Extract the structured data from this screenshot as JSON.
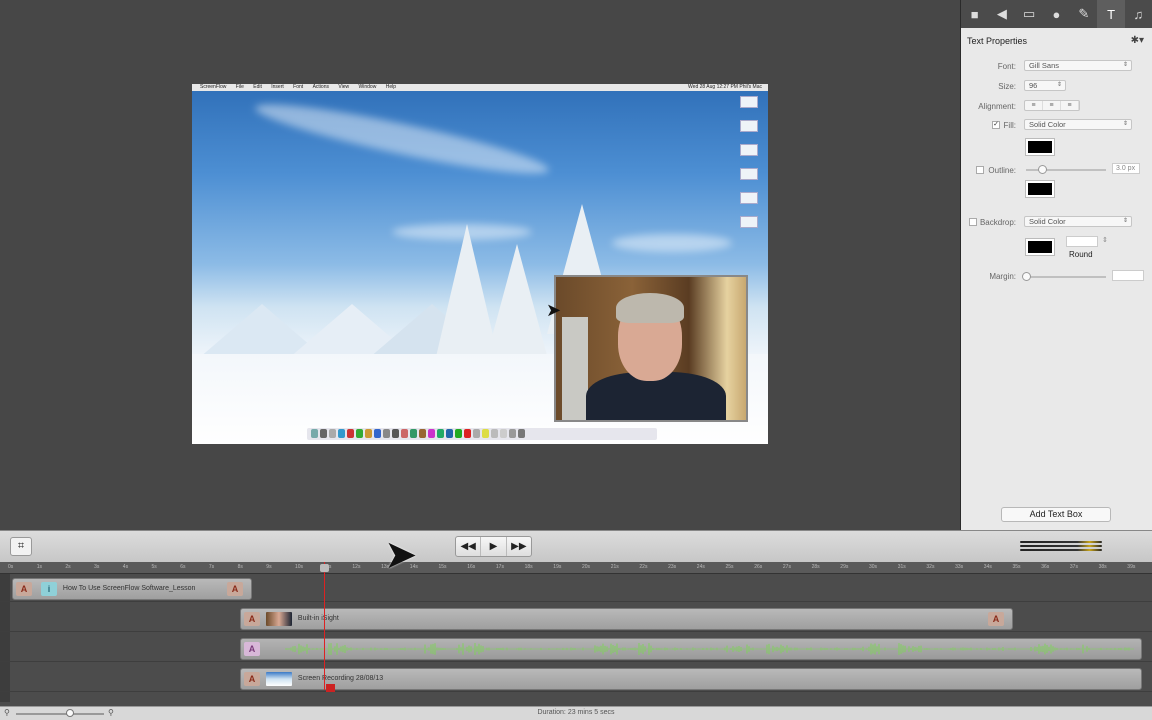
{
  "mac_menubar": {
    "app": "ScreenFlow",
    "items": [
      "File",
      "Edit",
      "Insert",
      "Font",
      "Actions",
      "View",
      "Window",
      "Help"
    ],
    "status": "Wed 28 Aug 12:27 PM  Phil's Mac"
  },
  "inspector": {
    "toolbar": [
      "video-camera-icon",
      "speaker-icon",
      "screen-icon",
      "callout-icon",
      "annotation-icon",
      "text-icon",
      "media-library-icon"
    ],
    "title": "Text Properties",
    "font_label": "Font:",
    "font_value": "Gill Sans",
    "size_label": "Size:",
    "size_value": "96",
    "alignment_label": "Alignment:",
    "fill_label": "Fill:",
    "fill_value": "Solid Color",
    "fill_checked": "✓",
    "outline_label": "Outline:",
    "outline_value": "3.0 px",
    "backdrop_label": "Backdrop:",
    "backdrop_value": "Solid Color",
    "round_label": "Round",
    "margin_label": "Margin:",
    "add_text_box": "Add Text Box"
  },
  "transport": {
    "rewind": "◀◀",
    "play": "▶",
    "forward": "▶▶"
  },
  "timeline": {
    "ruler_ticks": [
      "0s",
      "1s",
      "2s",
      "3s",
      "4s",
      "5s",
      "6s",
      "7s",
      "8s",
      "9s",
      "10s",
      "11s",
      "12s",
      "13s",
      "14s",
      "15s",
      "16s",
      "17s",
      "18s",
      "19s",
      "20s",
      "21s",
      "22s",
      "23s",
      "24s",
      "25s",
      "26s",
      "27s",
      "28s",
      "29s",
      "30s",
      "31s",
      "32s",
      "33s",
      "34s",
      "35s",
      "36s",
      "37s",
      "38s",
      "39s"
    ],
    "clips": {
      "text_clip": "How To Use ScreenFlow Software_Lesson",
      "isight_clip": "Built-in iSight",
      "screen_clip": "Screen Recording 28/08/13"
    },
    "a_marker": "A",
    "i_marker": "i"
  },
  "status_bar": {
    "duration": "Duration: 23 mins 5 secs"
  }
}
